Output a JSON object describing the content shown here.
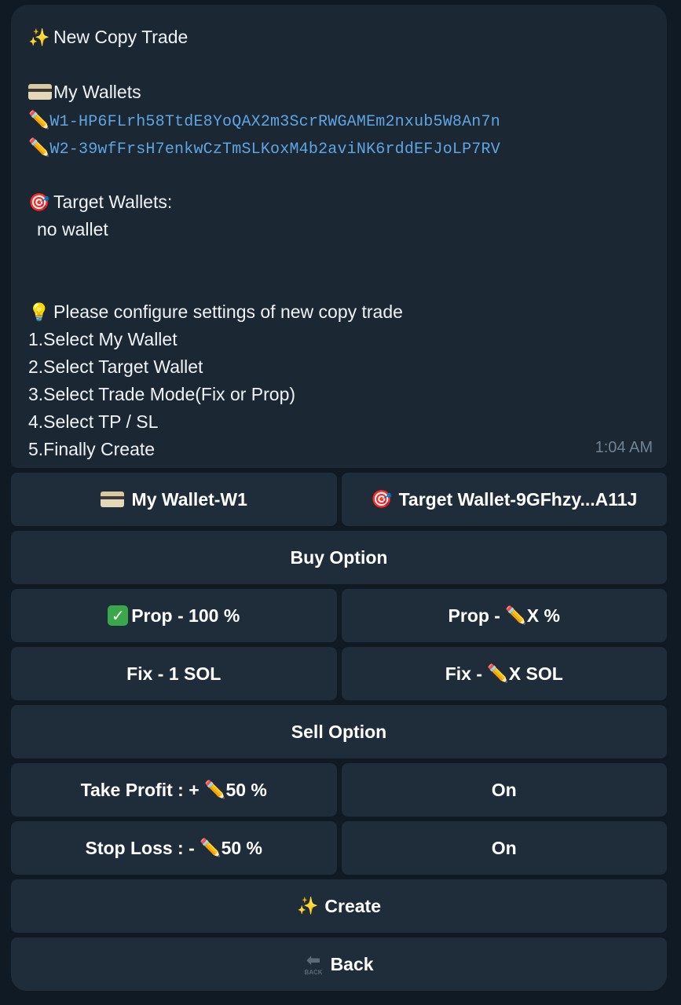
{
  "message": {
    "title_icon": "sparkles",
    "title": "New Copy Trade",
    "wallets_icon": "credit-card",
    "wallets_header": "My Wallets",
    "wallets": [
      {
        "icon": "pencil",
        "label": "W1-",
        "address": "HP6FLrh58TtdE8YoQAX2m3ScrRWGAMEm2nxub5W8An7n"
      },
      {
        "icon": "pencil",
        "label": "W2-",
        "address": "39wfFrsH7enkwCzTmSLKoxM4b2aviNK6rddEFJoLP7RV"
      }
    ],
    "targets_icon": "direct-hit",
    "targets_header": "Target Wallets:",
    "targets_value": "no wallet",
    "tip_icon": "light-bulb",
    "tip_text": "Please configure settings of new copy trade",
    "steps": [
      "1.Select My Wallet",
      "2.Select Target Wallet",
      "3.Select Trade Mode(Fix or Prop)",
      "4.Select TP / SL",
      "5.Finally Create"
    ],
    "timestamp": "1:04 AM"
  },
  "keyboard": {
    "my_wallet": "My Wallet-W1",
    "target_wallet": "Target Wallet-9GFhzy...A11J",
    "buy_option": "Buy Option",
    "prop_100": "Prop - 100 %",
    "prop_x_prefix": "Prop - ",
    "prop_x_suffix": "X %",
    "fix_1": "Fix - 1 SOL",
    "fix_x_prefix": "Fix - ",
    "fix_x_suffix": "X SOL",
    "sell_option": "Sell Option",
    "tp_prefix": "Take Profit : + ",
    "tp_suffix": "50 %",
    "tp_state": "On",
    "sl_prefix": "Stop Loss : - ",
    "sl_suffix": "50 %",
    "sl_state": "On",
    "create": "Create",
    "back": "Back",
    "back_icon_text": "BACK"
  },
  "colors": {
    "background": "#0f1a24",
    "bubble": "#1b2733",
    "button": "#1f2c39",
    "address": "#5ea6e3",
    "timestamp": "#6f8395"
  }
}
